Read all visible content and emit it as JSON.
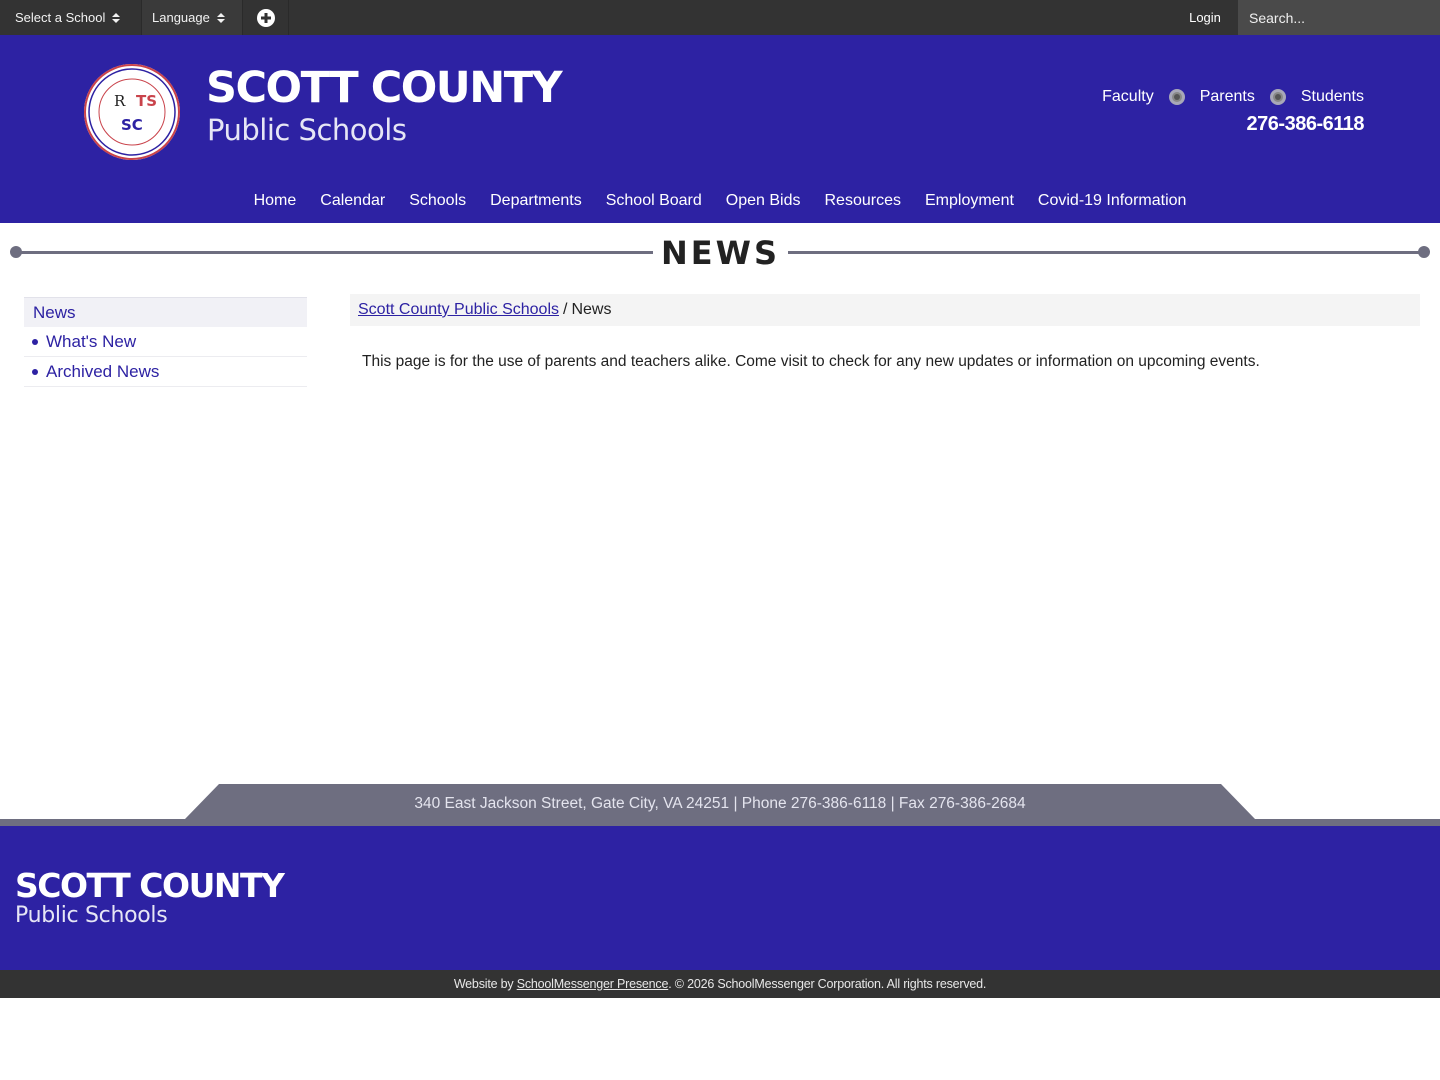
{
  "topbar": {
    "school_selector": "Select a School",
    "language_selector": "Language",
    "plus_icon": "plus-circle-icon",
    "login": "Login",
    "search_placeholder": "Search..."
  },
  "header": {
    "title": "SCOTT COUNTY",
    "subtitle": "Public Schools",
    "quick_links": [
      "Faculty",
      "Parents",
      "Students"
    ],
    "phone": "276-386-6118"
  },
  "nav": [
    "Home",
    "Calendar",
    "Schools",
    "Departments",
    "School Board",
    "Open Bids",
    "Resources",
    "Employment",
    "Covid-19 Information"
  ],
  "page_title": "NEWS",
  "sidebar": {
    "heading": "News",
    "items": [
      "What's New",
      "Archived News"
    ]
  },
  "breadcrumb": {
    "home": "Scott County Public Schools",
    "separator": "/",
    "current": "News"
  },
  "content": {
    "intro": "This page is for the use of parents and teachers alike. Come visit to check for any new updates or information on upcoming events."
  },
  "footer": {
    "address": "340 East Jackson Street, Gate City, VA 24251 | Phone 276-386-6118 | Fax 276-386-2684",
    "title": "SCOTT COUNTY",
    "subtitle": "Public Schools",
    "credit_prefix": "Website by",
    "credit_link": "SchoolMessenger Presence",
    "credit_suffix": ". © 2026 SchoolMessenger Corporation. All rights reserved."
  },
  "colors": {
    "brand": "#2d22a3",
    "topbar": "#333333",
    "band": "#6e6e80"
  }
}
